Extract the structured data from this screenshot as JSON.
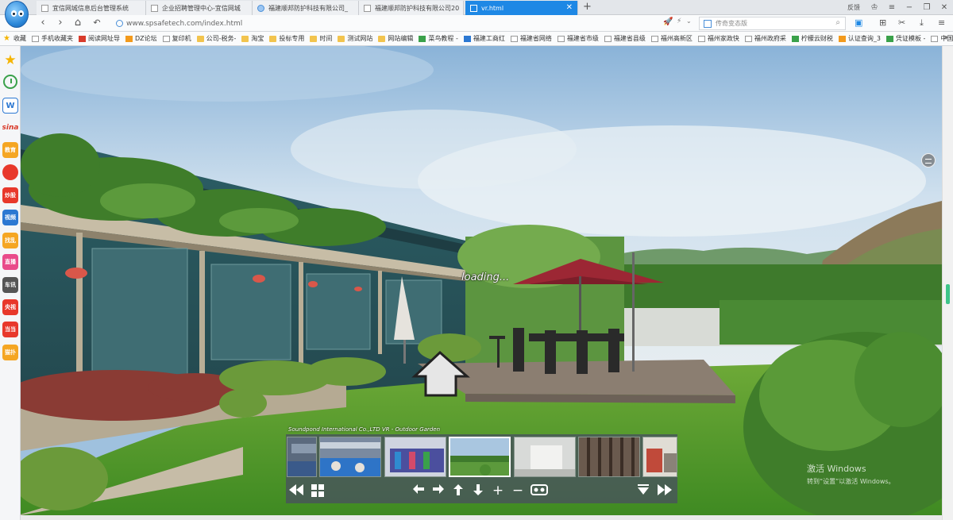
{
  "tabs": [
    {
      "title": "宜信网城信息后台管理系统",
      "active": false
    },
    {
      "title": "企业招聘管理中心-宜信网城",
      "active": false
    },
    {
      "title": "福建顺邦防护科技有限公司_",
      "active": false
    },
    {
      "title": "福建顺邦防护科技有限公司20",
      "active": false
    },
    {
      "title": "vr.html",
      "active": true
    }
  ],
  "window": {
    "feedback": "反馈"
  },
  "address": {
    "url": "www.spsafetech.com/index.html"
  },
  "search": {
    "placeholder": "传奇变态版"
  },
  "bookmarks": [
    {
      "label": "收藏",
      "icon": "star-icon"
    },
    {
      "label": "手机收藏夹",
      "icon": "page-icon"
    },
    {
      "label": "阅读网址导",
      "icon": "red-icon"
    },
    {
      "label": "DZ论坛",
      "icon": "orange-icon"
    },
    {
      "label": "复印机",
      "icon": "page-icon"
    },
    {
      "label": "公司-税务-",
      "icon": "folder-icon"
    },
    {
      "label": "淘宝",
      "icon": "folder-icon"
    },
    {
      "label": "投标专用",
      "icon": "folder-icon"
    },
    {
      "label": "时间",
      "icon": "folder-icon"
    },
    {
      "label": "测试网站",
      "icon": "folder-icon"
    },
    {
      "label": "网站编辑",
      "icon": "folder-icon"
    },
    {
      "label": "菜鸟教程 -",
      "icon": "green-icon"
    },
    {
      "label": "福建工商红",
      "icon": "blue-icon"
    },
    {
      "label": "福建省网络",
      "icon": "page-icon"
    },
    {
      "label": "福建省市级",
      "icon": "page-icon"
    },
    {
      "label": "福建省县级",
      "icon": "page-icon"
    },
    {
      "label": "福州高新区",
      "icon": "page-icon"
    },
    {
      "label": "福州家政快",
      "icon": "page-icon"
    },
    {
      "label": "福州政府采",
      "icon": "page-icon"
    },
    {
      "label": "柠檬云财税",
      "icon": "green-icon"
    },
    {
      "label": "认证查询_3",
      "icon": "orange-icon"
    },
    {
      "label": "凭证模板 -",
      "icon": "green-icon"
    },
    {
      "label": "中国质量认",
      "icon": "page-icon"
    }
  ],
  "sidebar": [
    {
      "label": "",
      "icon": "star-icon",
      "color": "#f5b400"
    },
    {
      "label": "",
      "icon": "clock-icon",
      "color": "#3aa14a"
    },
    {
      "label": "W",
      "icon": "word-icon",
      "color": "#2c78d2"
    },
    {
      "label": "sina",
      "icon": "sina-icon",
      "color": "#d93b2b"
    },
    {
      "label": "教育",
      "icon": "education-icon",
      "color": "#f5a623"
    },
    {
      "label": "",
      "icon": "weibo-icon",
      "color": "#e8382b"
    },
    {
      "label": "炒股",
      "icon": "stock-icon",
      "color": "#e8382b"
    },
    {
      "label": "视频",
      "icon": "video-icon",
      "color": "#2c78d2"
    },
    {
      "label": "找乱",
      "icon": "search-icon",
      "color": "#f5a623"
    },
    {
      "label": "直播",
      "icon": "live-icon",
      "color": "#e94b8a"
    },
    {
      "label": "车讯",
      "icon": "car-icon",
      "color": "#555555"
    },
    {
      "label": "央视",
      "icon": "cctv-icon",
      "color": "#e8382b"
    },
    {
      "label": "当当",
      "icon": "dangdang-icon",
      "color": "#e8382b"
    },
    {
      "label": "猫扑",
      "icon": "mop-icon",
      "color": "#f5a623"
    }
  ],
  "vr": {
    "loading": "loading...",
    "tour_title": "Soundpond International Co.,LTD VR - Outdoor Garden",
    "thumbs": [
      {
        "name": "scene-1",
        "active": false
      },
      {
        "name": "scene-2",
        "active": false
      },
      {
        "name": "scene-3",
        "active": false
      },
      {
        "name": "scene-4",
        "active": true
      },
      {
        "name": "scene-5",
        "active": false
      },
      {
        "name": "scene-6",
        "active": false
      },
      {
        "name": "scene-7",
        "active": false
      }
    ]
  },
  "watermark": {
    "title": "激活 Windows",
    "subtitle": "转到“设置”以激活 Windows。"
  }
}
